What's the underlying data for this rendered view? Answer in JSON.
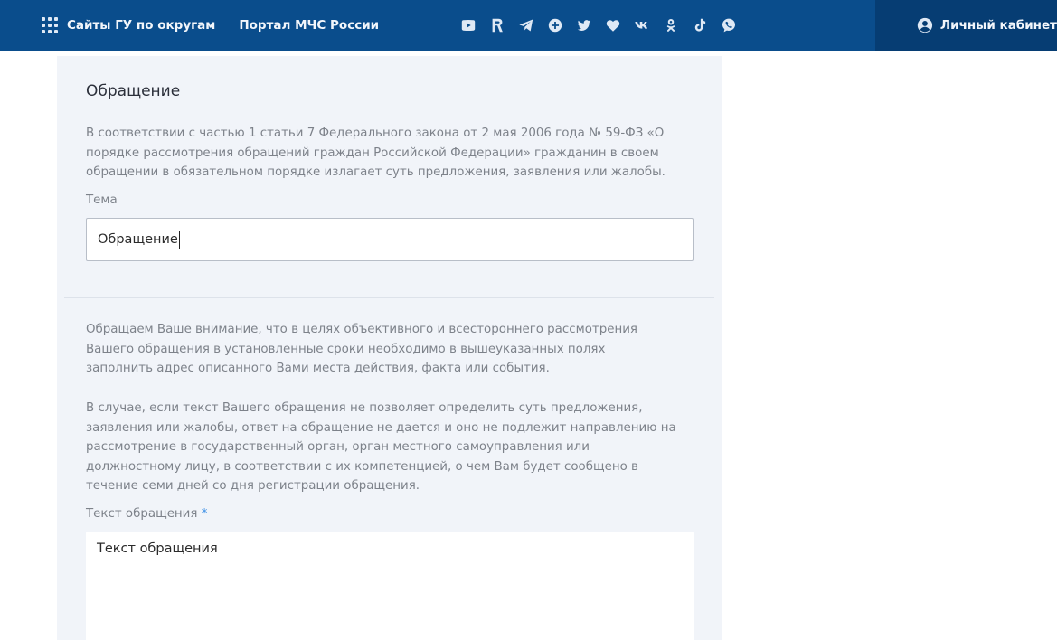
{
  "header": {
    "regions_link": "Сайты ГУ по округам",
    "portal_link": "Портал МЧС России",
    "socials": [
      "youtube-icon",
      "rutube-icon",
      "telegram-icon",
      "ok-share-icon",
      "twitter-icon",
      "heart-icon",
      "vk-icon",
      "odnoklassniki-icon",
      "tiktok-icon",
      "viber-icon"
    ],
    "cabinet_label": "Личный кабинет",
    "colors": {
      "bar": "#0a4d8c",
      "cabinet_bg": "#063d73"
    }
  },
  "form": {
    "title": "Обращение",
    "notice_1": [
      "В соответствии с частью 1 статьи 7 Федерального закона от 2 мая 2006 года № 59-ФЗ «О",
      "порядке рассмотрения обращений граждан Российской Федерации» гражданин в своем",
      "обращении в обязательном порядке излагает суть предложения, заявления или жалобы."
    ],
    "topic_label": "Тема",
    "topic_value": "Обращение",
    "notice_2": [
      "Обращаем Ваше внимание, что в целях объективного и всестороннего рассмотрения",
      "Вашего обращения в установленные сроки необходимо в вышеуказанных полях",
      "заполнить адрес описанного Вами места действия, факта или события."
    ],
    "notice_3": [
      "В случае, если текст Вашего обращения не позволяет определить суть предложения,",
      "заявления или жалобы, ответ на обращение не дается и оно не подлежит направлению на",
      "рассмотрение в государственный орган, орган местного самоуправления или",
      "должностному лицу, в соответствии с их компетенцией, о чем Вам будет сообщено в",
      "течение семи дней со дня регистрации обращения."
    ],
    "text_label": "Текст обращения",
    "required_mark": "*",
    "text_placeholder": "Текст обращения",
    "colors": {
      "panel": "#f1f4f9",
      "muted_text": "#7d828a",
      "required": "#3a8ee6"
    }
  }
}
